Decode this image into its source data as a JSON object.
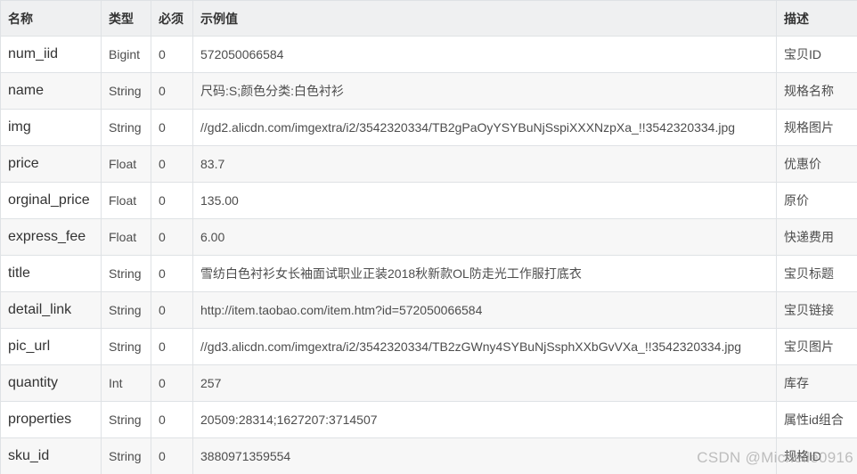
{
  "table": {
    "headers": [
      "名称",
      "类型",
      "必须",
      "示例值",
      "描述"
    ],
    "rows": [
      {
        "name": "num_iid",
        "type": "Bigint",
        "required": "0",
        "example": "572050066584",
        "desc": "宝贝ID"
      },
      {
        "name": "name",
        "type": "String",
        "required": "0",
        "example": "尺码:S;颜色分类:白色衬衫",
        "desc": "规格名称"
      },
      {
        "name": "img",
        "type": "String",
        "required": "0",
        "example": "//gd2.alicdn.com/imgextra/i2/3542320334/TB2gPaOyYSYBuNjSspiXXXNzpXa_!!3542320334.jpg",
        "desc": "规格图片"
      },
      {
        "name": "price",
        "type": "Float",
        "required": "0",
        "example": "83.7",
        "desc": "优惠价"
      },
      {
        "name": "orginal_price",
        "type": "Float",
        "required": "0",
        "example": "135.00",
        "desc": "原价"
      },
      {
        "name": "express_fee",
        "type": "Float",
        "required": "0",
        "example": "6.00",
        "desc": "快递费用"
      },
      {
        "name": "title",
        "type": "String",
        "required": "0",
        "example": "雪纺白色衬衫女长袖面试职业正装2018秋新款OL防走光工作服打底衣",
        "desc": "宝贝标题"
      },
      {
        "name": "detail_link",
        "type": "String",
        "required": "0",
        "example": "http://item.taobao.com/item.htm?id=572050066584",
        "desc": "宝贝链接"
      },
      {
        "name": "pic_url",
        "type": "String",
        "required": "0",
        "example": "//gd3.alicdn.com/imgextra/i2/3542320334/TB2zGWny4SYBuNjSsphXXbGvVXa_!!3542320334.jpg",
        "desc": "宝贝图片"
      },
      {
        "name": "quantity",
        "type": "Int",
        "required": "0",
        "example": "257",
        "desc": "库存"
      },
      {
        "name": "properties",
        "type": "String",
        "required": "0",
        "example": "20509:28314;1627207:3714507",
        "desc": "属性id组合"
      },
      {
        "name": "sku_id",
        "type": "String",
        "required": "0",
        "example": "3880971359554",
        "desc": "规格ID"
      }
    ]
  },
  "watermark": "CSDN @Michelle0916"
}
